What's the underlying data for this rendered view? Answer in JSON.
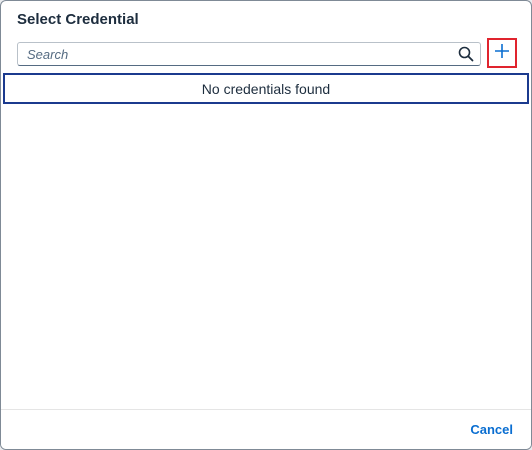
{
  "dialog": {
    "title": "Select Credential"
  },
  "toolbar": {
    "search": {
      "placeholder": "Search",
      "value": "",
      "icon": "search-icon"
    },
    "add_button": {
      "icon": "plus-icon",
      "label": "+"
    }
  },
  "list": {
    "empty_text": "No credentials found"
  },
  "footer": {
    "cancel_label": "Cancel"
  },
  "colors": {
    "accent": "#0a6ed1",
    "title_text": "#1d2d3e",
    "highlight_border": "#e0242e",
    "focus_border": "#1b3a8e"
  }
}
